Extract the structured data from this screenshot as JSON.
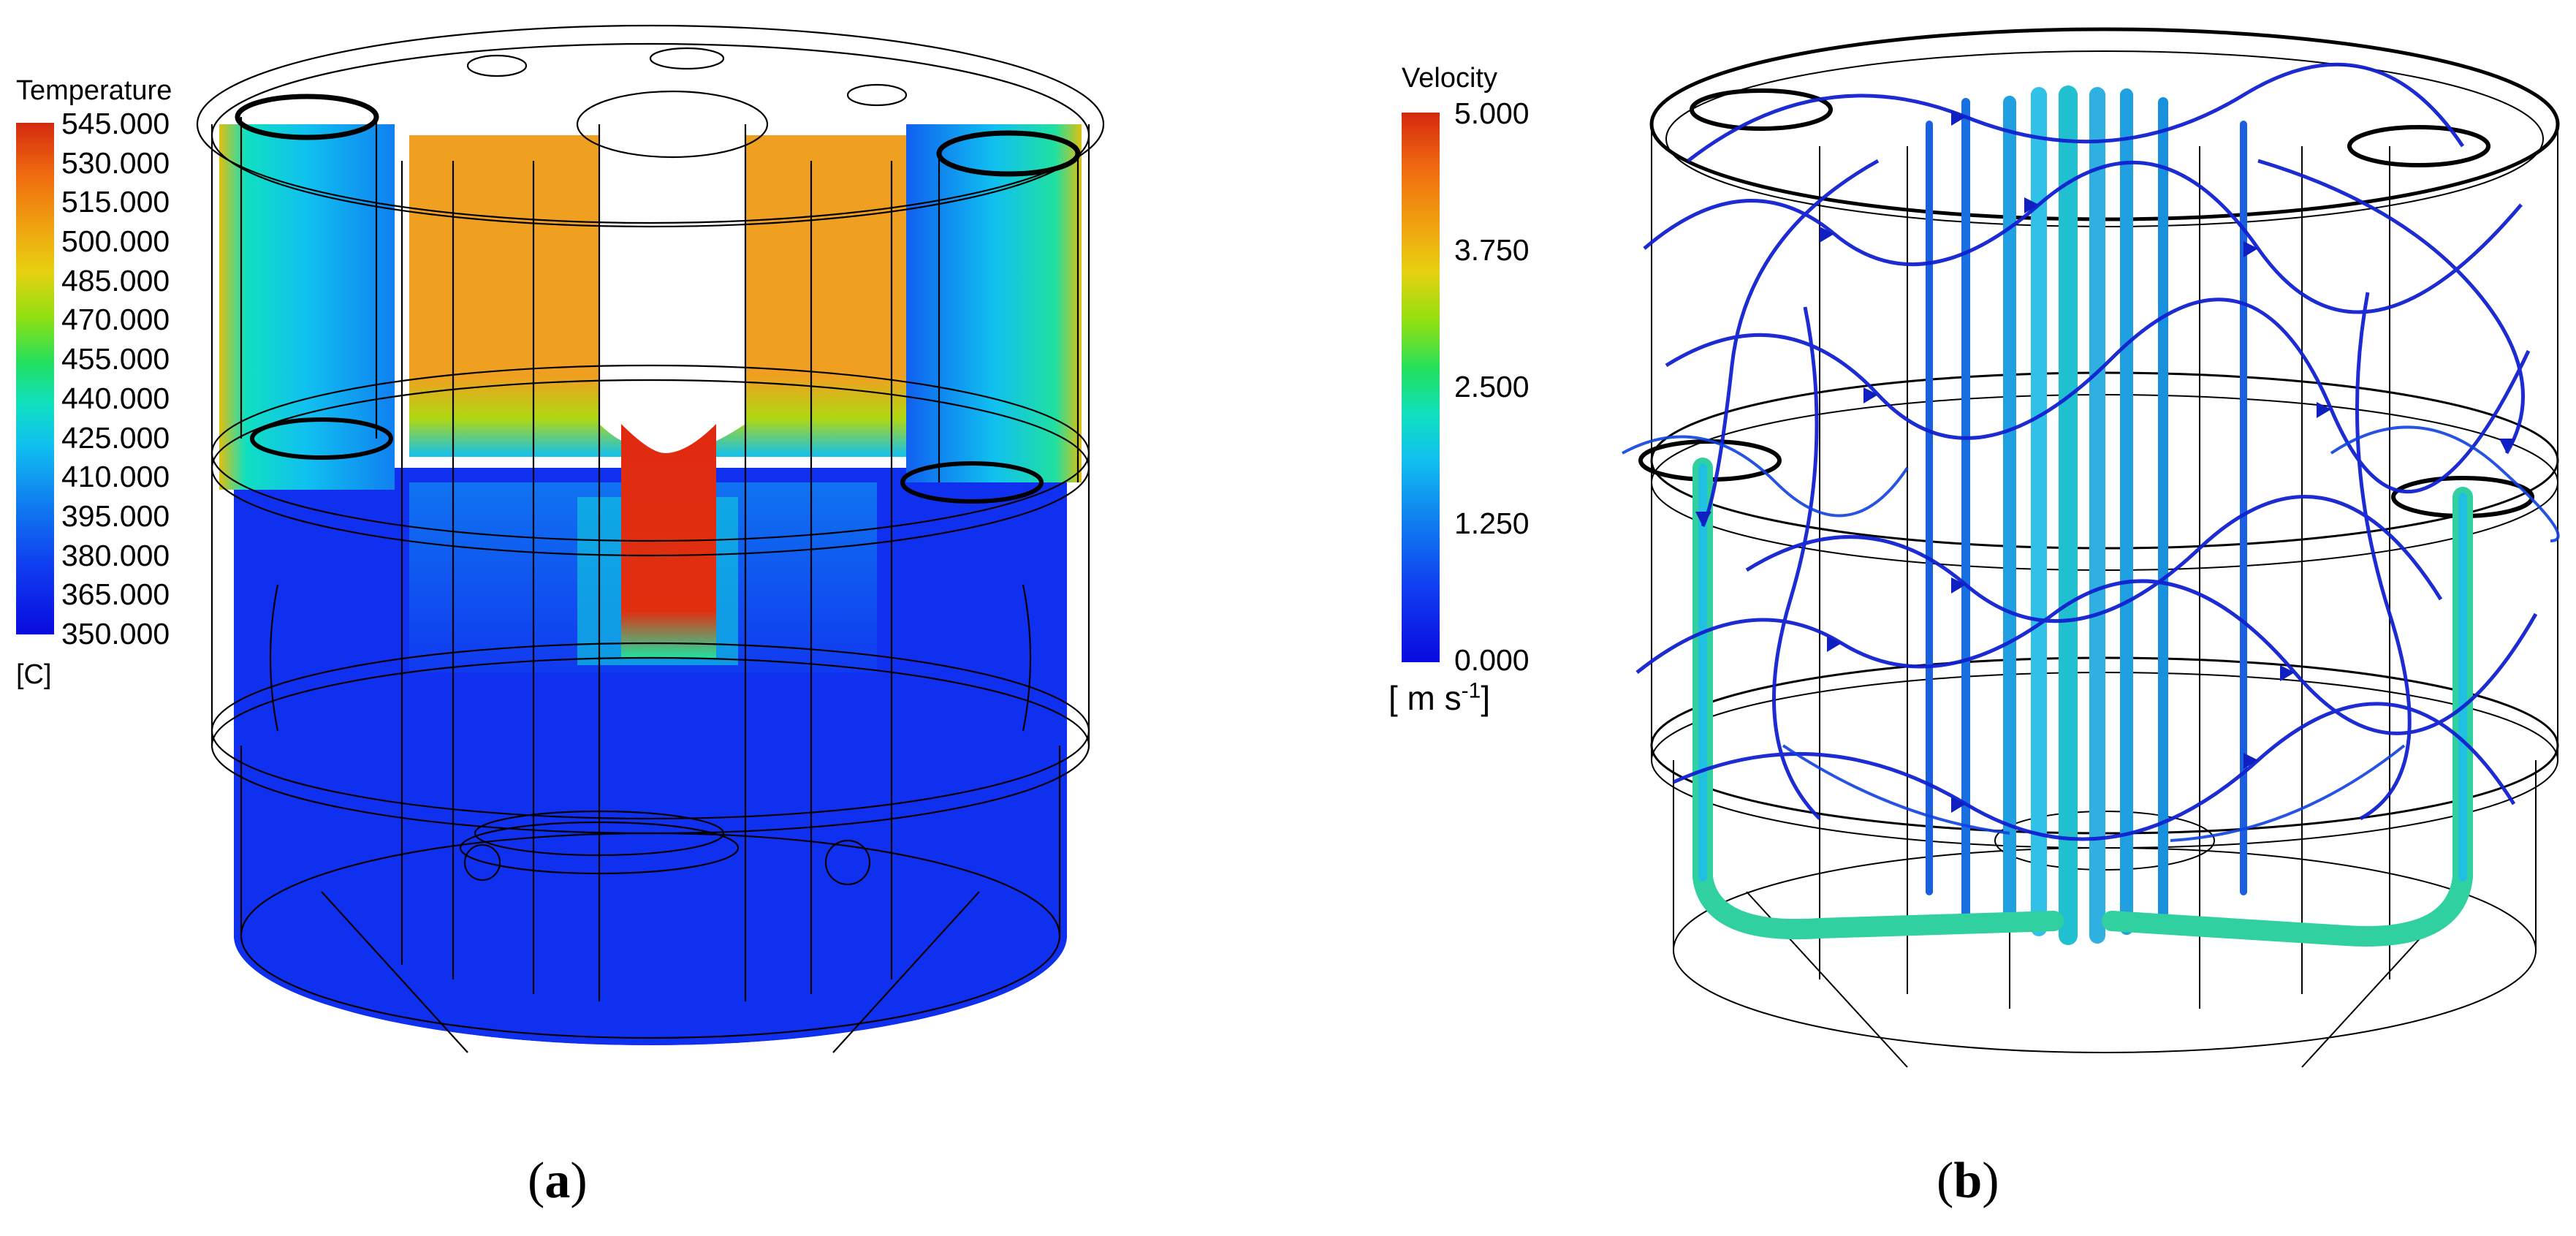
{
  "panel_a": {
    "legend": {
      "title": "Temperature",
      "unit": "[C]",
      "ticks": [
        "545.000",
        "530.000",
        "515.000",
        "500.000",
        "485.000",
        "470.000",
        "455.000",
        "440.000",
        "425.000",
        "410.000",
        "395.000",
        "380.000",
        "365.000",
        "350.000"
      ],
      "min": 350,
      "max": 545
    },
    "caption_paren_open": "(",
    "caption_letter": "a",
    "caption_paren_close": ")"
  },
  "panel_b": {
    "legend": {
      "title": "Velocity",
      "unit": "[ m s",
      "unit_exp": "-1",
      "unit_close": "]",
      "ticks": [
        "5.000",
        "3.750",
        "2.500",
        "1.250",
        "0.000"
      ],
      "min": 0,
      "max": 5
    },
    "caption_paren_open": "(",
    "caption_letter": "b",
    "caption_paren_close": ")"
  },
  "colors": {
    "rainbow": [
      "#d42a10",
      "#f06a10",
      "#f0a010",
      "#e0d010",
      "#90e010",
      "#20e060",
      "#10e0c0",
      "#10c0f0",
      "#1080f0",
      "#1040f0",
      "#0a0ae0"
    ],
    "temp_hot": "#e02a10",
    "temp_warm": "#f0a020",
    "temp_cold": "#1030f0",
    "velocity_low": "#1020d0",
    "velocity_mid": "#20c0e0",
    "velocity_high": "#40e080"
  }
}
